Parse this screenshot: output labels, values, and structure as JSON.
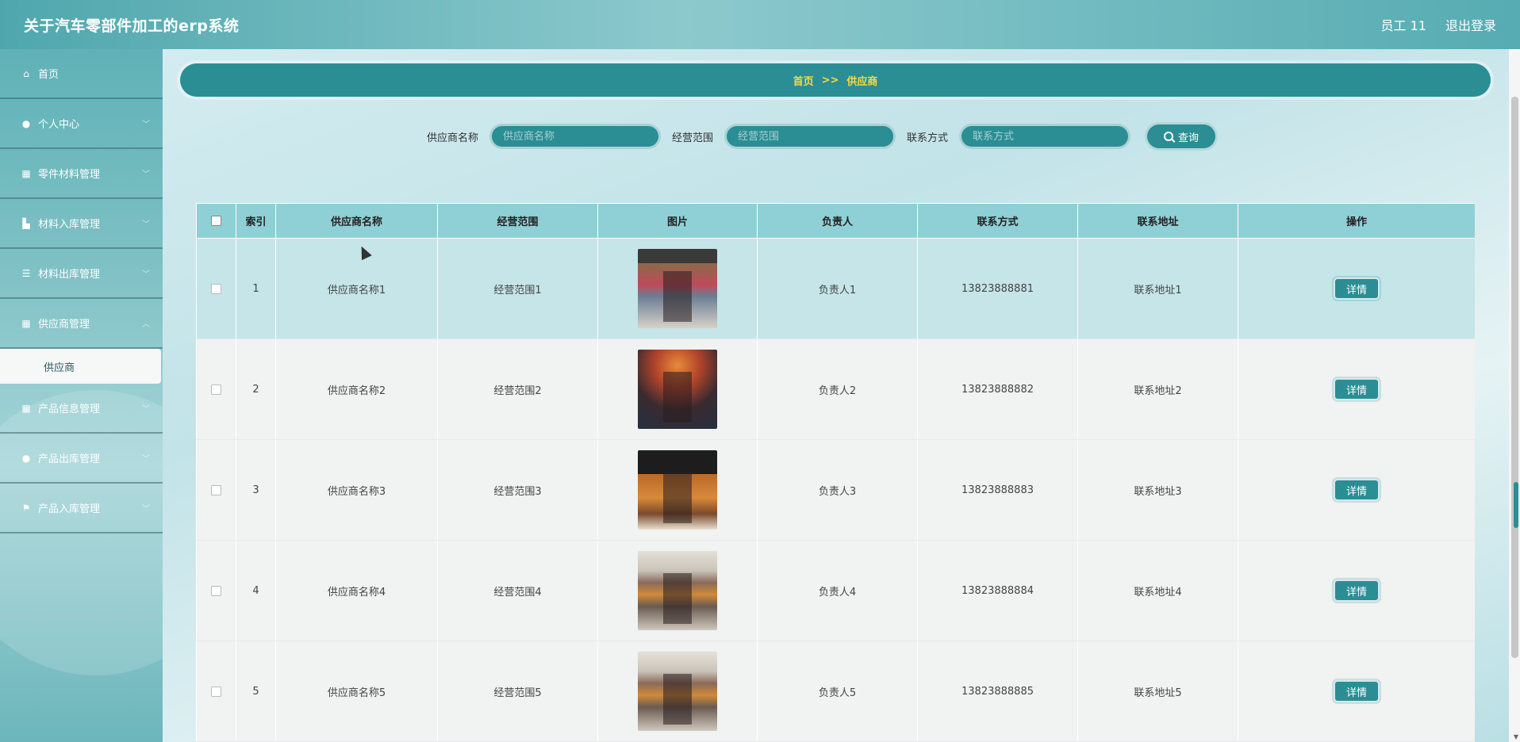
{
  "header": {
    "title": "关于汽车零部件加工的erp系统",
    "user": "员工 11",
    "logout": "退出登录"
  },
  "sidebar": {
    "items": [
      {
        "label": "首页",
        "icon": "home-icon"
      },
      {
        "label": "个人中心",
        "icon": "user-icon"
      },
      {
        "label": "零件材料管理",
        "icon": "grid-icon"
      },
      {
        "label": "材料入库管理",
        "icon": "inbox-icon"
      },
      {
        "label": "材料出库管理",
        "icon": "sliders-icon"
      },
      {
        "label": "供应商管理",
        "icon": "grid-icon"
      },
      {
        "label": "产品信息管理",
        "icon": "grid-icon"
      },
      {
        "label": "产品出库管理",
        "icon": "user-icon"
      },
      {
        "label": "产品入库管理",
        "icon": "flag-icon"
      }
    ],
    "submenu": {
      "label": "供应商"
    }
  },
  "breadcrumb": {
    "home": "首页",
    "sep": ">>",
    "current": "供应商"
  },
  "search": {
    "name_label": "供应商名称",
    "name_placeholder": "供应商名称",
    "scope_label": "经营范围",
    "scope_placeholder": "经营范围",
    "contact_label": "联系方式",
    "contact_placeholder": "联系方式",
    "button": "查询"
  },
  "table": {
    "headers": [
      "索引",
      "供应商名称",
      "经营范围",
      "图片",
      "负责人",
      "联系方式",
      "联系地址",
      "操作"
    ],
    "action_label": "详情",
    "rows": [
      {
        "idx": "1",
        "name": "供应商名称1",
        "scope": "经营范围1",
        "owner": "负责人1",
        "phone": "13823888881",
        "address": "联系地址1"
      },
      {
        "idx": "2",
        "name": "供应商名称2",
        "scope": "经营范围2",
        "owner": "负责人2",
        "phone": "13823888882",
        "address": "联系地址2"
      },
      {
        "idx": "3",
        "name": "供应商名称3",
        "scope": "经营范围3",
        "owner": "负责人3",
        "phone": "13823888883",
        "address": "联系地址3"
      },
      {
        "idx": "4",
        "name": "供应商名称4",
        "scope": "经营范围4",
        "owner": "负责人4",
        "phone": "13823888884",
        "address": "联系地址4"
      },
      {
        "idx": "5",
        "name": "供应商名称5",
        "scope": "经营范围5",
        "owner": "负责人5",
        "phone": "13823888885",
        "address": "联系地址5"
      }
    ]
  },
  "colors": {
    "accent": "#2a8e94",
    "header_row": "#8fd0d6",
    "breadcrumb_text": "#f5d94a"
  }
}
